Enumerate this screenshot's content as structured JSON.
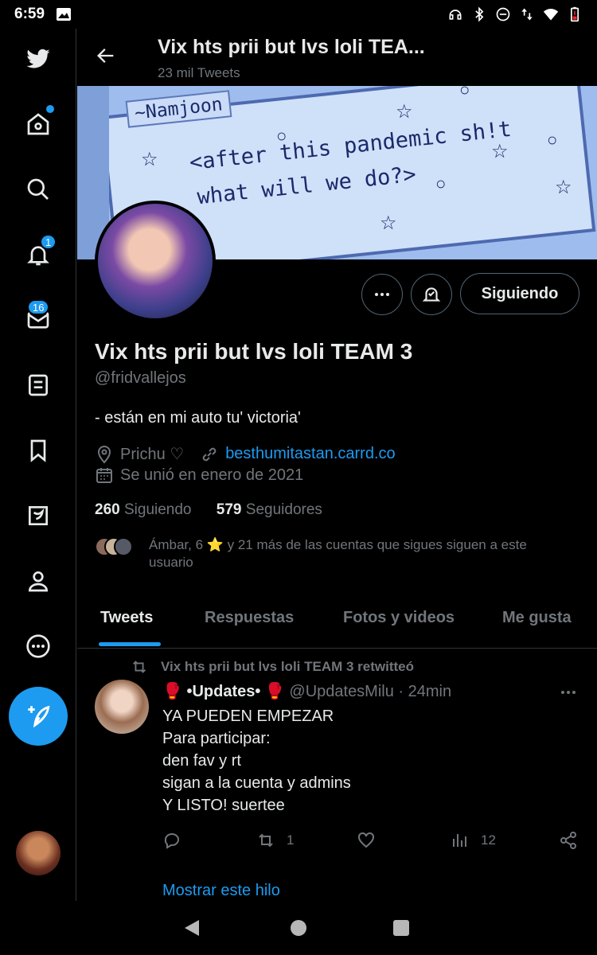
{
  "status_bar": {
    "time": "6:59"
  },
  "sidebar": {
    "notifications_badge": "1",
    "messages_badge": "16"
  },
  "header": {
    "title": "Vix hts prii but lvs loli TEA...",
    "subtitle": "23 mil Tweets"
  },
  "banner": {
    "tag": "~Namjoon",
    "line1": "<after this pandemic sh!t",
    "line2": "what will we do?>"
  },
  "profile": {
    "follow_label": "Siguiendo",
    "name": "Vix hts prii but lvs loli TEAM 3",
    "handle": "@fridvallejos",
    "bio": "- están en mi auto tu' victoria'",
    "location": "Prichu ♡",
    "link": "besthumitastan.carrd.co",
    "joined": "Se unió en enero de 2021",
    "following_count": "260",
    "following_label": "Siguiendo",
    "followers_count": "579",
    "followers_label": "Seguidores",
    "followed_by": "Ámbar, 6 ⭐ y 21 más de las cuentas que sigues siguen a este usuario"
  },
  "tabs": [
    "Tweets",
    "Respuestas",
    "Fotos y videos",
    "Me gusta"
  ],
  "tweet": {
    "retweeted_by": "Vix hts prii but lvs loli TEAM 3 retwitteó",
    "author": "🥊 •Updates• 🥊",
    "handle_time": "@UpdatesMilu · 24min",
    "lines": [
      "YA PUEDEN EMPEZAR",
      "Para participar:",
      "den fav y rt",
      "sigan a la cuenta y admins",
      "Y LISTO! suertee"
    ],
    "retweets": "1",
    "views": "12",
    "show_thread": "Mostrar este hilo"
  },
  "colors": {
    "accent": "#1d9bf0",
    "background": "#000000",
    "muted": "#71767b"
  }
}
